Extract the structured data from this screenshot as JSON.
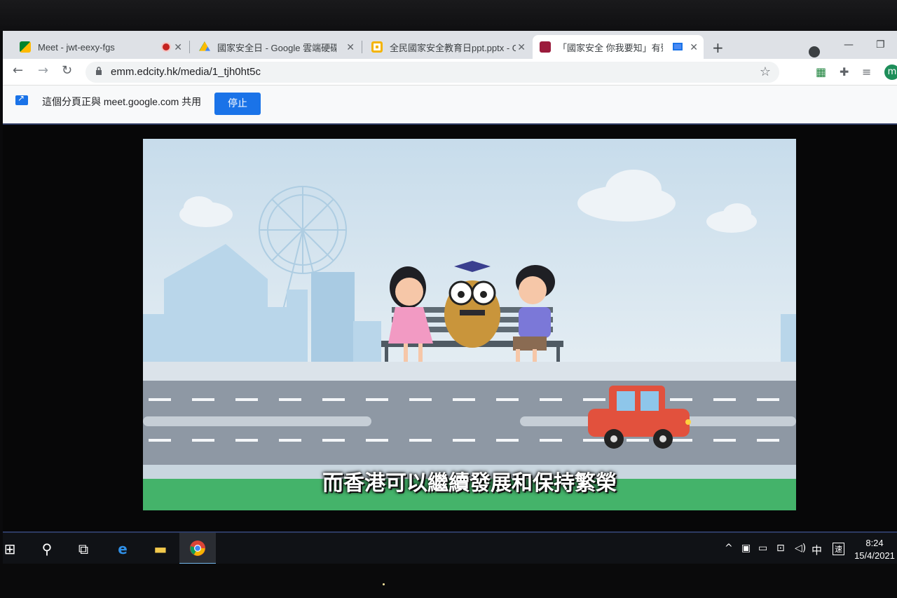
{
  "tabs": [
    {
      "title": "Meet - jwt-eexy-fgs",
      "favicon": "google-meet-icon",
      "recording": true
    },
    {
      "title": "國家安全日 - Google 雲端硬碟",
      "favicon": "google-drive-icon"
    },
    {
      "title": "全民國家安全教育日ppt.pptx - G",
      "favicon": "google-slides-icon"
    },
    {
      "title": "「國家安全 你我要知」有聲",
      "favicon": "edcity-icon",
      "casting": true,
      "active": true
    }
  ],
  "toolbar": {
    "url": "emm.edcity.hk/media/1_tjh0ht5c"
  },
  "sharebar": {
    "message": "這個分頁正與 meet.google.com 共用",
    "stop_label": "停止"
  },
  "video": {
    "subtitle": "而香港可以繼續發展和保持繁榮"
  },
  "profile": {
    "initial": "m"
  },
  "taskbar": {
    "ime": "中",
    "ime_mode": "速",
    "time": "8:24",
    "date": "15/4/2021"
  },
  "colors": {
    "accent": "#1a73e8",
    "taskbar": "#101216",
    "tab_bg": "#dee1e6"
  }
}
